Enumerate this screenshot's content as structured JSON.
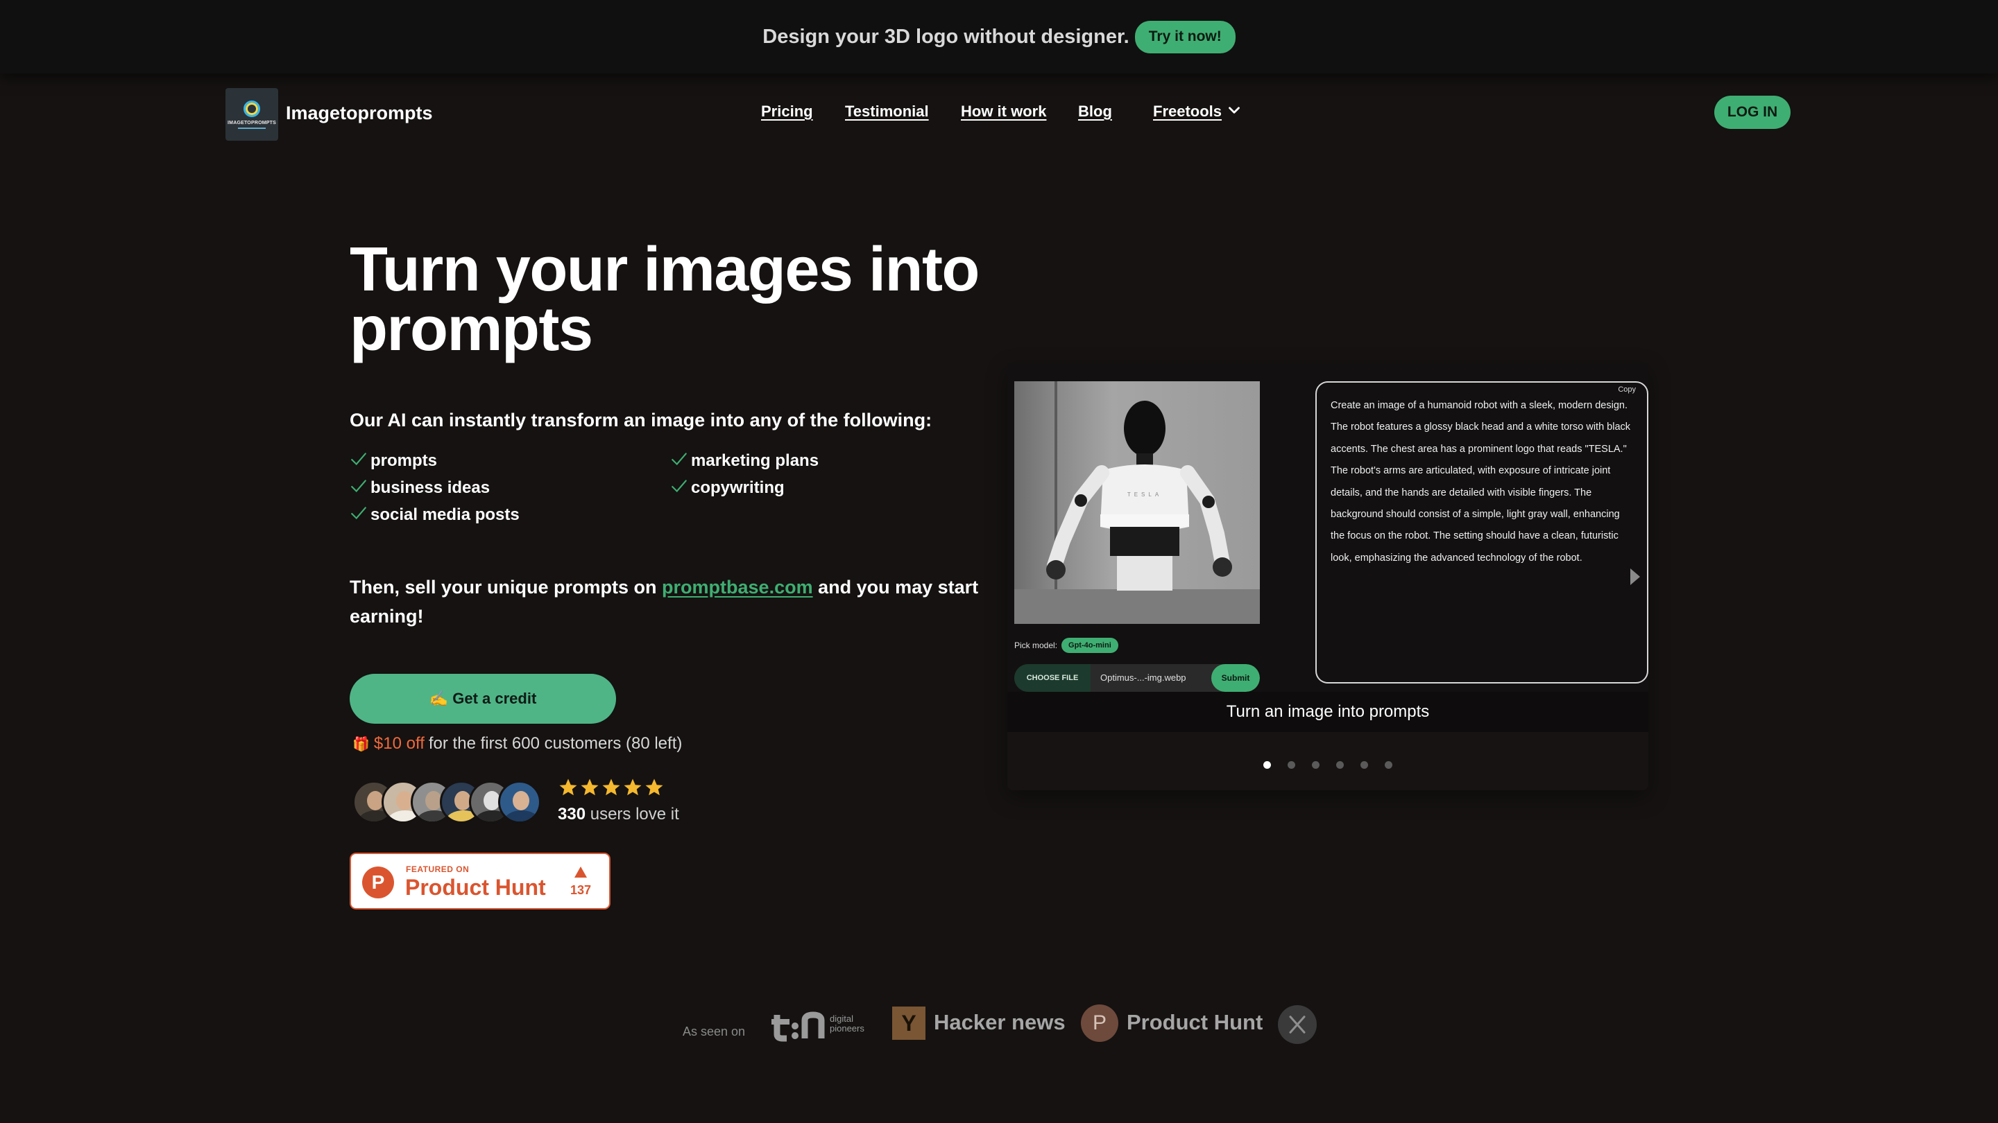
{
  "banner": {
    "text": "Design your 3D logo without designer.",
    "cta": "Try it now!"
  },
  "nav": {
    "logo_text": "IMAGETOPROMPTS",
    "brand": "Imagetoprompts",
    "links": [
      "Pricing",
      "Testimonial",
      "How it work",
      "Blog",
      "Freetools"
    ],
    "login": "LOG IN"
  },
  "hero": {
    "title": "Turn your images into prompts",
    "subhead": "Our AI can instantly transform an image into any of the following:",
    "features": [
      "prompts",
      "business ideas",
      "social media posts",
      "marketing plans",
      "copywriting"
    ],
    "sell_prefix": "Then, sell your unique prompts on",
    "sell_link": "promptbase.com",
    "sell_suffix": "and you may start earning!",
    "cta": "✍️ Get a credit",
    "offer_gift": "🎁",
    "offer_discount": "$10 off",
    "offer_rest": "for the first 600 customers (80 left)",
    "rating": 5,
    "users_count": "330",
    "users_text": "users love it"
  },
  "producthunt_badge": {
    "featured": "FEATURED ON",
    "name": "Product Hunt",
    "count": "137"
  },
  "carousel": {
    "pick_model_label": "Pick model:",
    "model": "Gpt-4o-mini",
    "choose_file": "CHOOSE FILE",
    "file_name": "Optimus-...-img.webp",
    "submit": "Submit",
    "copy": "Copy",
    "output": "Create an image of a humanoid robot with a sleek, modern design. The robot features a glossy black head and a white torso with black accents. The chest area has a prominent logo that reads \"TESLA.\" The robot's arms are articulated, with exposure of intricate joint details, and the hands are detailed with visible fingers. The background should consist of a simple, light gray wall, enhancing the focus on the robot. The setting should have a clean, futuristic look, emphasizing the advanced technology of the robot.",
    "robot_chest_text": "TESLA",
    "caption": "Turn an image into prompts",
    "slide_count": 6,
    "active_slide": 1
  },
  "as_seen_on": {
    "label": "As seen on",
    "tn_sub": "digital pioneers",
    "hn_letter": "Y",
    "hn": "Hacker news",
    "ph_letter": "P",
    "ph": "Product Hunt"
  },
  "colors": {
    "accent": "#3fae72",
    "background": "#151211",
    "offer": "#f06a3c",
    "producthunt": "#da552f",
    "star": "#f5b82e"
  }
}
